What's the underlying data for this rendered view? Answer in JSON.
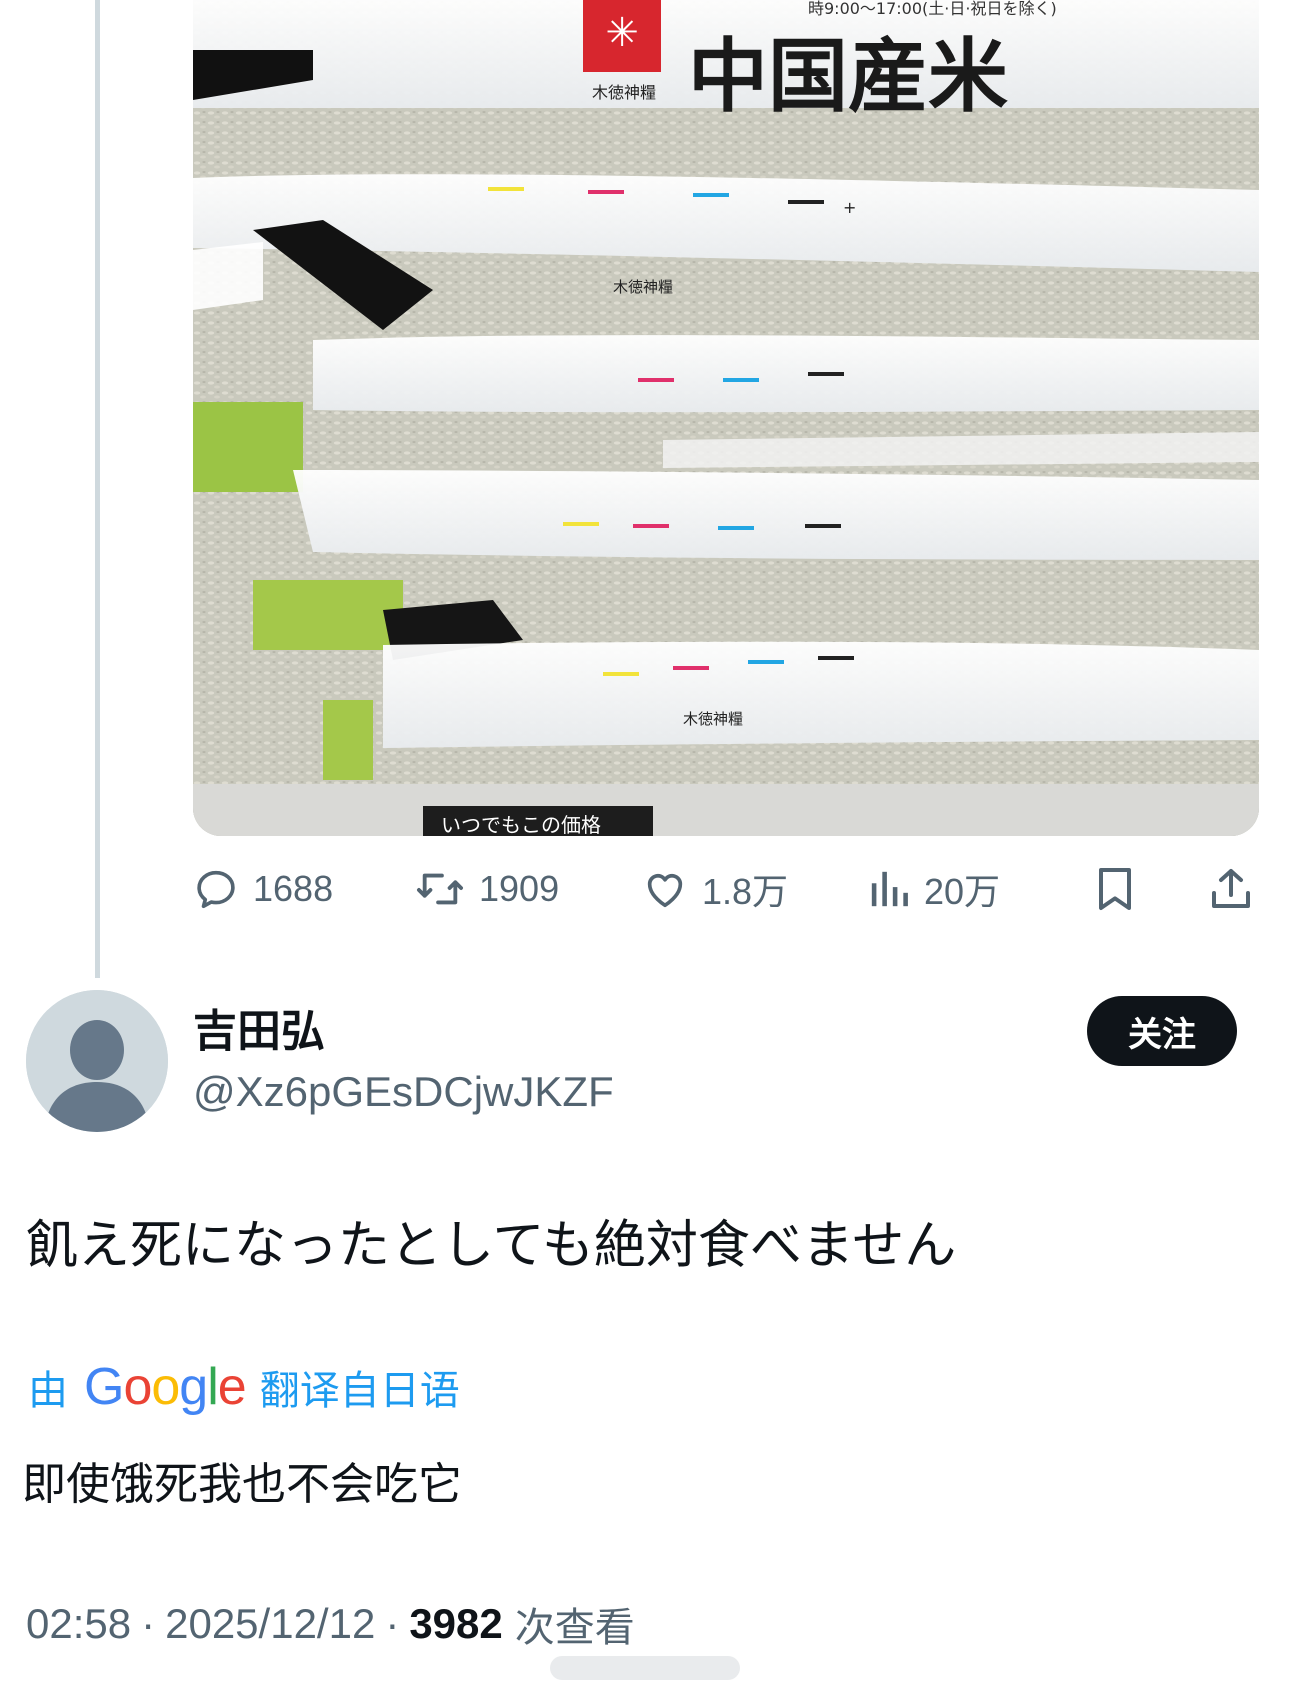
{
  "media": {
    "bag_label_title": "中国産米",
    "bag_label_brand": "木徳神糧",
    "bag_label_hours": "時9:00〜17:00(土·日·祝日を除く)",
    "shelf_tag": "いつでもこの価格"
  },
  "actions": {
    "replies": "1688",
    "retweets": "1909",
    "likes": "1.8万",
    "views": "20万"
  },
  "author": {
    "name": "吉田弘",
    "handle": "@Xz6pGEsDCjwJKZF",
    "follow_label": "关注"
  },
  "tweet": {
    "text": "飢え死になったとしても絶対食べません",
    "translate_prefix": "由",
    "translate_brand": "Google",
    "translate_suffix": "翻译自日语",
    "translated_text": "即使饿死我也不会吃它"
  },
  "meta": {
    "time": "02:58",
    "separator": "·",
    "date": "2025/12/12",
    "views_count": "3982",
    "views_label": "次查看"
  },
  "colors": {
    "text_primary": "#0f1419",
    "text_secondary": "#536471",
    "link_blue": "#1d9bf0",
    "thread_line": "#cfd9de",
    "button_dark": "#0f1419"
  },
  "icons": [
    "reply-icon",
    "retweet-icon",
    "like-icon",
    "views-icon",
    "bookmark-icon",
    "share-icon",
    "default-avatar-icon"
  ]
}
